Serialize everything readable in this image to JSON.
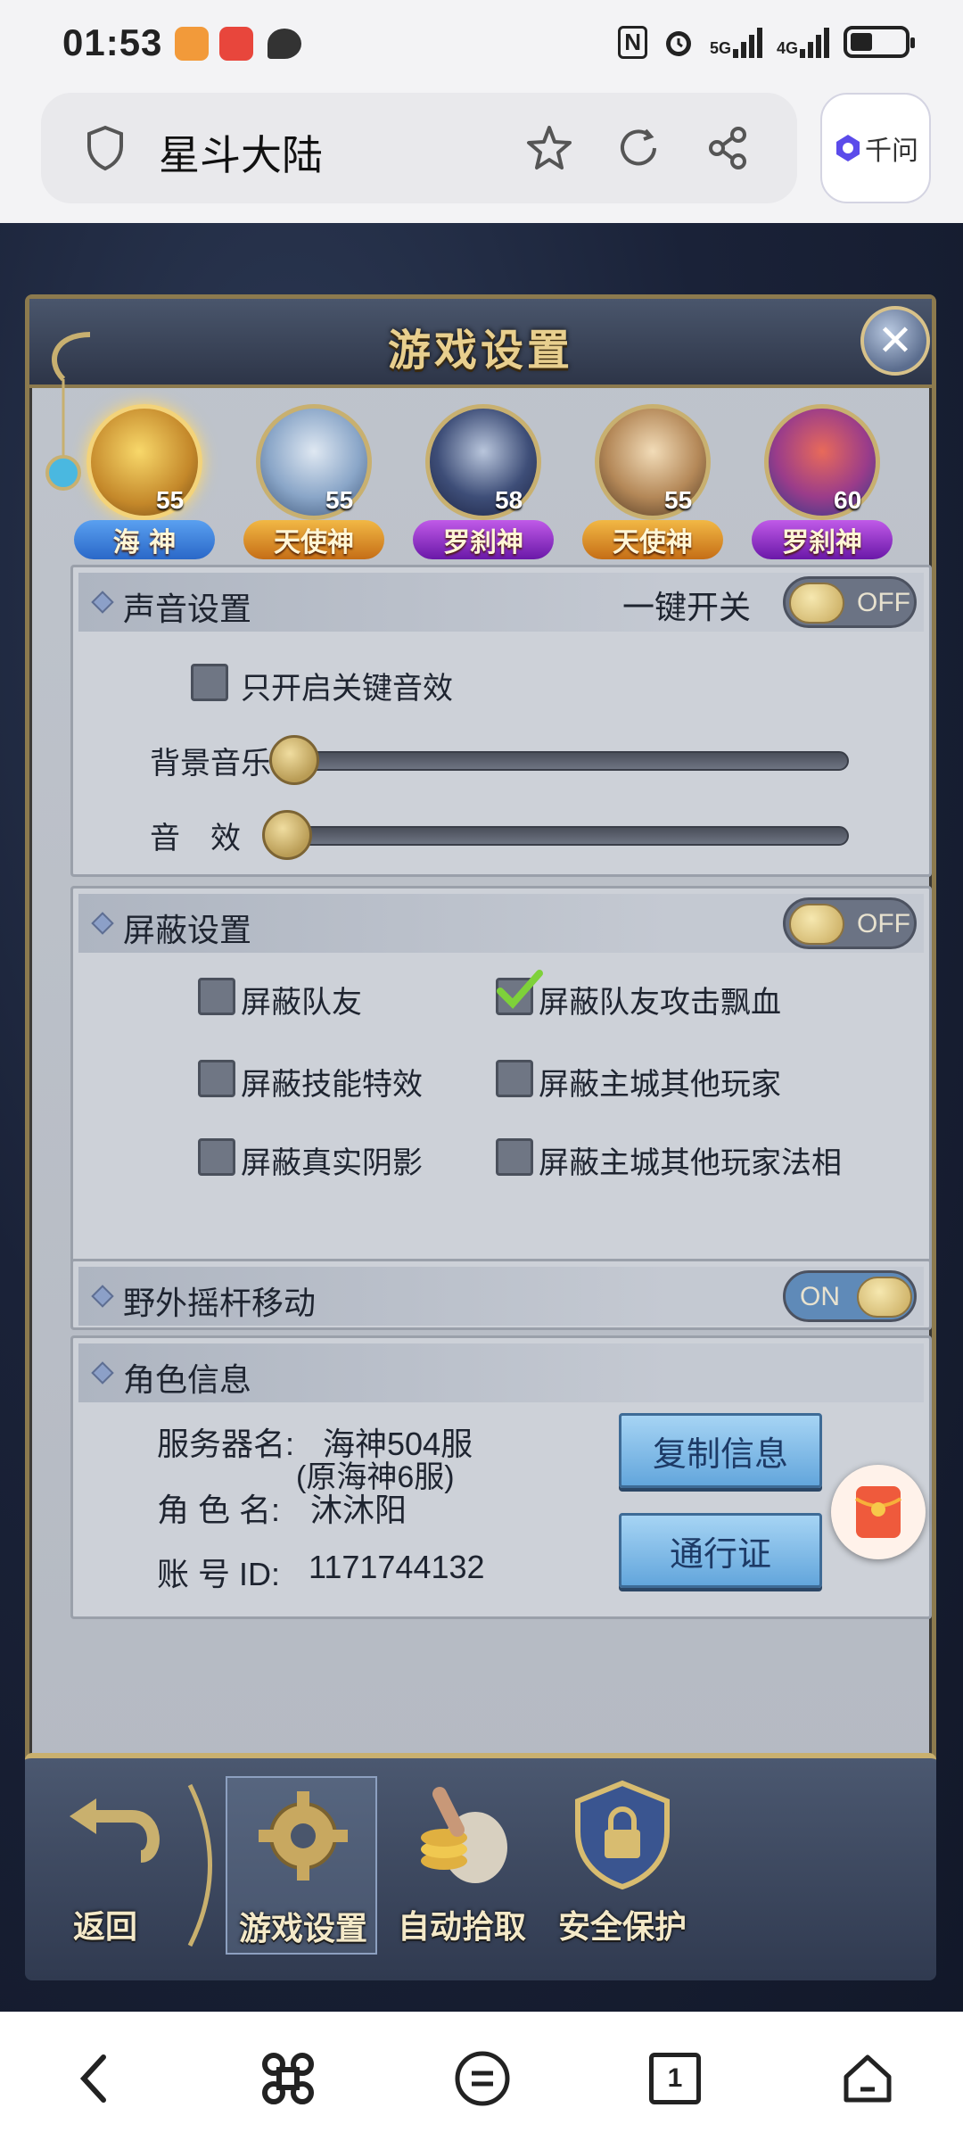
{
  "status_bar": {
    "time": "01:53",
    "network_1": "5G",
    "network_2": "4G"
  },
  "browser": {
    "page_title": "星斗大陆",
    "assistant_button": "千问"
  },
  "game": {
    "title": "游戏设置",
    "close_symbol": "✕",
    "characters": [
      {
        "level": "55",
        "badge": "海 神",
        "badge_color": "#2a68c8"
      },
      {
        "level": "55",
        "badge": "天使神",
        "badge_color": "#d4891c"
      },
      {
        "level": "58",
        "badge": "罗刹神",
        "badge_color": "#8a2bc4"
      },
      {
        "level": "55",
        "badge": "天使神",
        "badge_color": "#d4891c"
      },
      {
        "level": "60",
        "badge": "罗刹神",
        "badge_color": "#8a2bc4"
      }
    ],
    "sound": {
      "title": "声音设置",
      "one_key_label": "一键开关",
      "one_key_toggle": "OFF",
      "key_sfx_only": "只开启关键音效",
      "bgm_label": "背景音乐",
      "sfx_label": "音　效"
    },
    "block": {
      "title": "屏蔽设置",
      "toggle": "OFF",
      "options": [
        {
          "label": "屏蔽队友",
          "checked": false
        },
        {
          "label": "屏蔽队友攻击飘血",
          "checked": true
        },
        {
          "label": "屏蔽技能特效",
          "checked": false
        },
        {
          "label": "屏蔽主城其他玩家",
          "checked": false
        },
        {
          "label": "屏蔽真实阴影",
          "checked": false
        },
        {
          "label": "屏蔽主城其他玩家法相",
          "checked": false
        }
      ]
    },
    "joystick": {
      "title": "野外摇杆移动",
      "toggle": "ON"
    },
    "role": {
      "title": "角色信息",
      "server_label": "服务器名:",
      "server_value": "海神504服",
      "server_note": "(原海神6服)",
      "name_label": "角 色 名:",
      "name_value": "沐沐阳",
      "id_label": "账 号 ID:",
      "id_value": "1171744132",
      "copy_button": "复制信息",
      "pass_button": "通行证"
    },
    "bottom_tabs": {
      "back": "返回",
      "settings": "游戏设置",
      "auto_pickup": "自动拾取",
      "security": "安全保护"
    }
  },
  "nav": {
    "page_count": "1"
  }
}
